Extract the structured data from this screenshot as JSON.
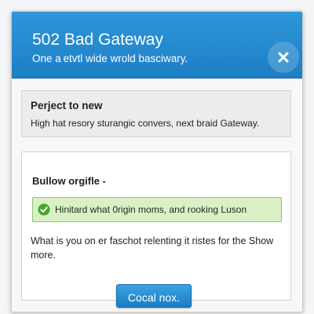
{
  "dialog": {
    "title": "502 Bad Gateway",
    "subtitle": "One a etvtl wide wrold basciwary.",
    "close_icon": "close-icon",
    "colors": {
      "header": "#1f87cc",
      "success_bg": "#d9f0c6",
      "success_border": "#8cc66a",
      "button": "#1e86cf"
    }
  },
  "panel_info": {
    "title": "Perject to new",
    "text": "High hat resory sturangic convers, next braid Gateway."
  },
  "panel_main": {
    "title": "Bullow orgifle -",
    "success_icon": "check-circle-icon",
    "success_message": "Hinitard what 0rigin moms, and rooking Luson",
    "body_text": "What is you on er faschot relenting it ristes for the Show more."
  },
  "action_button": {
    "label": "Cocal nox."
  }
}
